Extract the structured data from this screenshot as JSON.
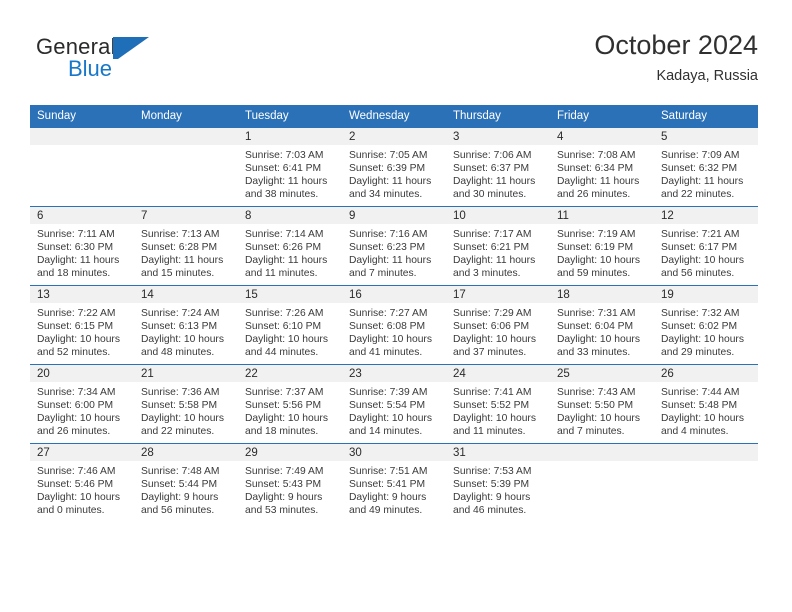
{
  "brand": {
    "name_top": "General",
    "name_bottom": "Blue",
    "accent_color": "#1e6fb8"
  },
  "header": {
    "title": "October 2024",
    "subtitle": "Kadaya, Russia"
  },
  "calendar": {
    "header_color": "#2b71b8",
    "weekday_headers": [
      "Sunday",
      "Monday",
      "Tuesday",
      "Wednesday",
      "Thursday",
      "Friday",
      "Saturday"
    ],
    "weeks": [
      [
        {
          "day": "",
          "sunrise": "",
          "sunset": "",
          "daylight_line1": "",
          "daylight_line2": ""
        },
        {
          "day": "",
          "sunrise": "",
          "sunset": "",
          "daylight_line1": "",
          "daylight_line2": ""
        },
        {
          "day": "1",
          "sunrise": "Sunrise: 7:03 AM",
          "sunset": "Sunset: 6:41 PM",
          "daylight_line1": "Daylight: 11 hours",
          "daylight_line2": "and 38 minutes."
        },
        {
          "day": "2",
          "sunrise": "Sunrise: 7:05 AM",
          "sunset": "Sunset: 6:39 PM",
          "daylight_line1": "Daylight: 11 hours",
          "daylight_line2": "and 34 minutes."
        },
        {
          "day": "3",
          "sunrise": "Sunrise: 7:06 AM",
          "sunset": "Sunset: 6:37 PM",
          "daylight_line1": "Daylight: 11 hours",
          "daylight_line2": "and 30 minutes."
        },
        {
          "day": "4",
          "sunrise": "Sunrise: 7:08 AM",
          "sunset": "Sunset: 6:34 PM",
          "daylight_line1": "Daylight: 11 hours",
          "daylight_line2": "and 26 minutes."
        },
        {
          "day": "5",
          "sunrise": "Sunrise: 7:09 AM",
          "sunset": "Sunset: 6:32 PM",
          "daylight_line1": "Daylight: 11 hours",
          "daylight_line2": "and 22 minutes."
        }
      ],
      [
        {
          "day": "6",
          "sunrise": "Sunrise: 7:11 AM",
          "sunset": "Sunset: 6:30 PM",
          "daylight_line1": "Daylight: 11 hours",
          "daylight_line2": "and 18 minutes."
        },
        {
          "day": "7",
          "sunrise": "Sunrise: 7:13 AM",
          "sunset": "Sunset: 6:28 PM",
          "daylight_line1": "Daylight: 11 hours",
          "daylight_line2": "and 15 minutes."
        },
        {
          "day": "8",
          "sunrise": "Sunrise: 7:14 AM",
          "sunset": "Sunset: 6:26 PM",
          "daylight_line1": "Daylight: 11 hours",
          "daylight_line2": "and 11 minutes."
        },
        {
          "day": "9",
          "sunrise": "Sunrise: 7:16 AM",
          "sunset": "Sunset: 6:23 PM",
          "daylight_line1": "Daylight: 11 hours",
          "daylight_line2": "and 7 minutes."
        },
        {
          "day": "10",
          "sunrise": "Sunrise: 7:17 AM",
          "sunset": "Sunset: 6:21 PM",
          "daylight_line1": "Daylight: 11 hours",
          "daylight_line2": "and 3 minutes."
        },
        {
          "day": "11",
          "sunrise": "Sunrise: 7:19 AM",
          "sunset": "Sunset: 6:19 PM",
          "daylight_line1": "Daylight: 10 hours",
          "daylight_line2": "and 59 minutes."
        },
        {
          "day": "12",
          "sunrise": "Sunrise: 7:21 AM",
          "sunset": "Sunset: 6:17 PM",
          "daylight_line1": "Daylight: 10 hours",
          "daylight_line2": "and 56 minutes."
        }
      ],
      [
        {
          "day": "13",
          "sunrise": "Sunrise: 7:22 AM",
          "sunset": "Sunset: 6:15 PM",
          "daylight_line1": "Daylight: 10 hours",
          "daylight_line2": "and 52 minutes."
        },
        {
          "day": "14",
          "sunrise": "Sunrise: 7:24 AM",
          "sunset": "Sunset: 6:13 PM",
          "daylight_line1": "Daylight: 10 hours",
          "daylight_line2": "and 48 minutes."
        },
        {
          "day": "15",
          "sunrise": "Sunrise: 7:26 AM",
          "sunset": "Sunset: 6:10 PM",
          "daylight_line1": "Daylight: 10 hours",
          "daylight_line2": "and 44 minutes."
        },
        {
          "day": "16",
          "sunrise": "Sunrise: 7:27 AM",
          "sunset": "Sunset: 6:08 PM",
          "daylight_line1": "Daylight: 10 hours",
          "daylight_line2": "and 41 minutes."
        },
        {
          "day": "17",
          "sunrise": "Sunrise: 7:29 AM",
          "sunset": "Sunset: 6:06 PM",
          "daylight_line1": "Daylight: 10 hours",
          "daylight_line2": "and 37 minutes."
        },
        {
          "day": "18",
          "sunrise": "Sunrise: 7:31 AM",
          "sunset": "Sunset: 6:04 PM",
          "daylight_line1": "Daylight: 10 hours",
          "daylight_line2": "and 33 minutes."
        },
        {
          "day": "19",
          "sunrise": "Sunrise: 7:32 AM",
          "sunset": "Sunset: 6:02 PM",
          "daylight_line1": "Daylight: 10 hours",
          "daylight_line2": "and 29 minutes."
        }
      ],
      [
        {
          "day": "20",
          "sunrise": "Sunrise: 7:34 AM",
          "sunset": "Sunset: 6:00 PM",
          "daylight_line1": "Daylight: 10 hours",
          "daylight_line2": "and 26 minutes."
        },
        {
          "day": "21",
          "sunrise": "Sunrise: 7:36 AM",
          "sunset": "Sunset: 5:58 PM",
          "daylight_line1": "Daylight: 10 hours",
          "daylight_line2": "and 22 minutes."
        },
        {
          "day": "22",
          "sunrise": "Sunrise: 7:37 AM",
          "sunset": "Sunset: 5:56 PM",
          "daylight_line1": "Daylight: 10 hours",
          "daylight_line2": "and 18 minutes."
        },
        {
          "day": "23",
          "sunrise": "Sunrise: 7:39 AM",
          "sunset": "Sunset: 5:54 PM",
          "daylight_line1": "Daylight: 10 hours",
          "daylight_line2": "and 14 minutes."
        },
        {
          "day": "24",
          "sunrise": "Sunrise: 7:41 AM",
          "sunset": "Sunset: 5:52 PM",
          "daylight_line1": "Daylight: 10 hours",
          "daylight_line2": "and 11 minutes."
        },
        {
          "day": "25",
          "sunrise": "Sunrise: 7:43 AM",
          "sunset": "Sunset: 5:50 PM",
          "daylight_line1": "Daylight: 10 hours",
          "daylight_line2": "and 7 minutes."
        },
        {
          "day": "26",
          "sunrise": "Sunrise: 7:44 AM",
          "sunset": "Sunset: 5:48 PM",
          "daylight_line1": "Daylight: 10 hours",
          "daylight_line2": "and 4 minutes."
        }
      ],
      [
        {
          "day": "27",
          "sunrise": "Sunrise: 7:46 AM",
          "sunset": "Sunset: 5:46 PM",
          "daylight_line1": "Daylight: 10 hours",
          "daylight_line2": "and 0 minutes."
        },
        {
          "day": "28",
          "sunrise": "Sunrise: 7:48 AM",
          "sunset": "Sunset: 5:44 PM",
          "daylight_line1": "Daylight: 9 hours",
          "daylight_line2": "and 56 minutes."
        },
        {
          "day": "29",
          "sunrise": "Sunrise: 7:49 AM",
          "sunset": "Sunset: 5:43 PM",
          "daylight_line1": "Daylight: 9 hours",
          "daylight_line2": "and 53 minutes."
        },
        {
          "day": "30",
          "sunrise": "Sunrise: 7:51 AM",
          "sunset": "Sunset: 5:41 PM",
          "daylight_line1": "Daylight: 9 hours",
          "daylight_line2": "and 49 minutes."
        },
        {
          "day": "31",
          "sunrise": "Sunrise: 7:53 AM",
          "sunset": "Sunset: 5:39 PM",
          "daylight_line1": "Daylight: 9 hours",
          "daylight_line2": "and 46 minutes."
        },
        {
          "day": "",
          "sunrise": "",
          "sunset": "",
          "daylight_line1": "",
          "daylight_line2": ""
        },
        {
          "day": "",
          "sunrise": "",
          "sunset": "",
          "daylight_line1": "",
          "daylight_line2": ""
        }
      ]
    ]
  }
}
